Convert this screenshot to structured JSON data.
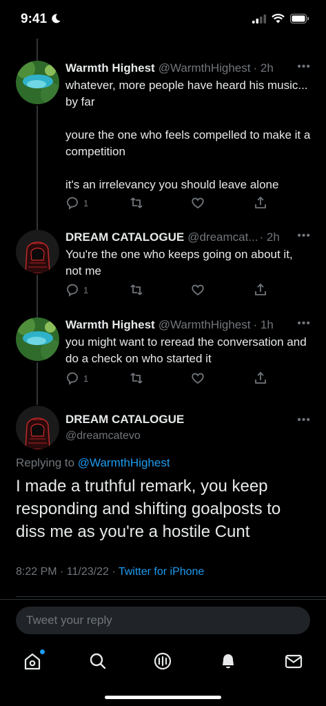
{
  "status": {
    "time": "9:41"
  },
  "tweets": [
    {
      "name": "Warmth Highest",
      "handle": "@WarmthHighest",
      "time": "· 2h",
      "text": "whatever, more people have heard his music... by far\n\nyoure the one who feels compelled to make it a competition\n\nit's an irrelevancy you should leave alone",
      "reply_count": "1"
    },
    {
      "name": "DREAM CATALOGUE",
      "handle": "@dreamcat...",
      "time": "· 2h",
      "text": "You're the one who keeps going on about it, not me",
      "reply_count": "1"
    },
    {
      "name": "Warmth Highest",
      "handle": "@WarmthHighest",
      "time": "· 1h",
      "text": "you might want to reread the conversation and do a check on who started it",
      "reply_count": "1"
    }
  ],
  "main": {
    "name": "DREAM CATALOGUE",
    "handle": "@dreamcatevo",
    "replying_prefix": "Replying to ",
    "replying_to": "@WarmthHighest",
    "text": "I made a truthful remark, you keep responding and shifting goalposts to diss me as you're a hostile Cunt",
    "datetime": "8:22 PM · 11/23/22 · ",
    "source": "Twitter for iPhone"
  },
  "reply": {
    "placeholder": "Tweet your reply"
  },
  "tabs": [
    "home-icon",
    "search-icon",
    "spaces-icon",
    "notifications-icon",
    "messages-icon"
  ],
  "colors": {
    "accent": "#1d9bf0",
    "muted": "#71767b",
    "background": "#000000"
  }
}
